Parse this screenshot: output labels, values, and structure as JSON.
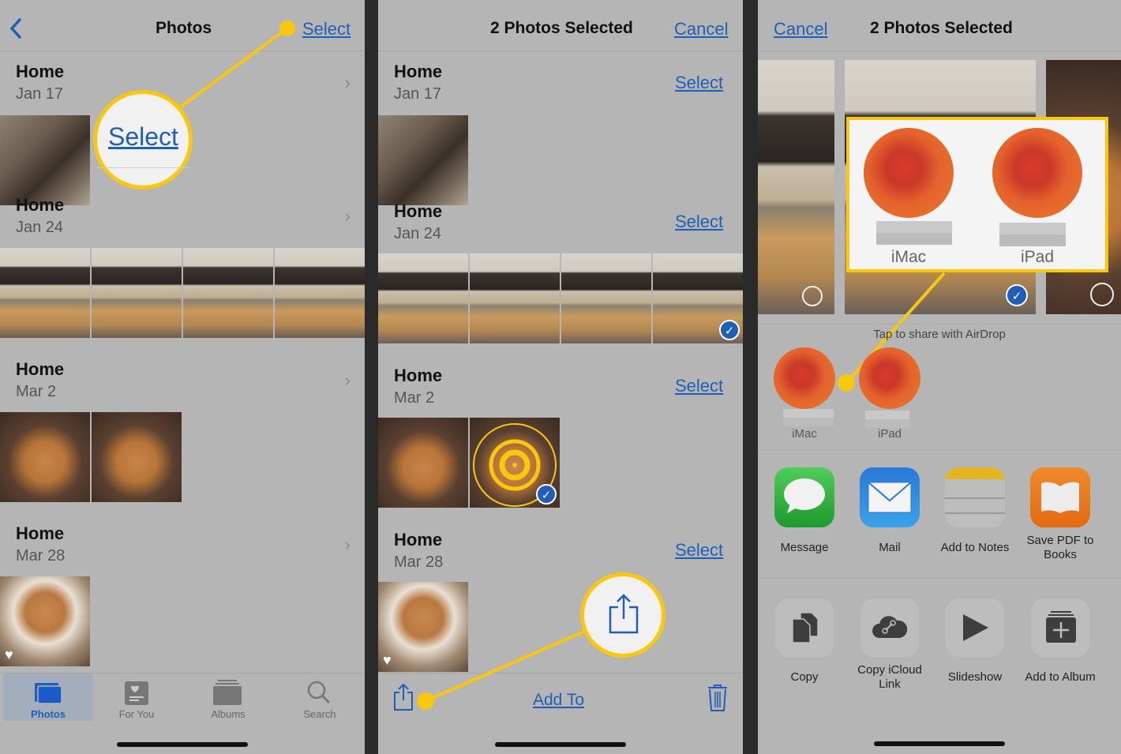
{
  "colors": {
    "accent_blue": "#1f5fb7",
    "callout_yellow": "#f9c80e",
    "dim_bg": "#b5b5b5"
  },
  "panel1": {
    "nav": {
      "back_icon": "chevron-left-icon",
      "title": "Photos",
      "select": "Select"
    },
    "callout_label": "Select",
    "sections": [
      {
        "title": "Home",
        "date": "Jan 17"
      },
      {
        "title": "Home",
        "date": "Jan 24"
      },
      {
        "title": "Home",
        "date": "Mar 2"
      },
      {
        "title": "Home",
        "date": "Mar 28"
      }
    ],
    "tabs": [
      {
        "label": "Photos",
        "icon": "photos-icon",
        "active": true
      },
      {
        "label": "For You",
        "icon": "for-you-icon",
        "active": false
      },
      {
        "label": "Albums",
        "icon": "albums-icon",
        "active": false
      },
      {
        "label": "Search",
        "icon": "search-icon",
        "active": false
      }
    ]
  },
  "panel2": {
    "nav": {
      "title": "2 Photos Selected",
      "cancel": "Cancel"
    },
    "sections": [
      {
        "title": "Home",
        "date": "Jan 17",
        "select": "Select"
      },
      {
        "title": "Home",
        "date": "Jan 24",
        "select": "Select"
      },
      {
        "title": "Home",
        "date": "Mar 2",
        "select": "Select"
      },
      {
        "title": "Home",
        "date": "Mar 28",
        "select": "Select"
      }
    ],
    "toolbar": {
      "share_icon": "share-icon",
      "add_to": "Add To",
      "trash_icon": "trash-icon"
    }
  },
  "panel3": {
    "nav": {
      "cancel": "Cancel",
      "title": "2 Photos Selected"
    },
    "airdrop_hint": "Tap to share with AirDrop",
    "callout_devices": [
      {
        "name": "iMac"
      },
      {
        "name": "iPad"
      }
    ],
    "devices": [
      {
        "name": "iMac"
      },
      {
        "name": "iPad"
      }
    ],
    "apps": [
      {
        "label": "Message",
        "icon": "messages-icon"
      },
      {
        "label": "Mail",
        "icon": "mail-icon"
      },
      {
        "label": "Add to Notes",
        "icon": "notes-icon"
      },
      {
        "label": "Save PDF to Books",
        "icon": "books-icon"
      }
    ],
    "actions": [
      {
        "label": "Copy",
        "icon": "copy-icon"
      },
      {
        "label": "Copy iCloud Link",
        "icon": "icloud-link-icon"
      },
      {
        "label": "Slideshow",
        "icon": "play-icon"
      },
      {
        "label": "Add to Album",
        "icon": "add-album-icon"
      }
    ]
  }
}
